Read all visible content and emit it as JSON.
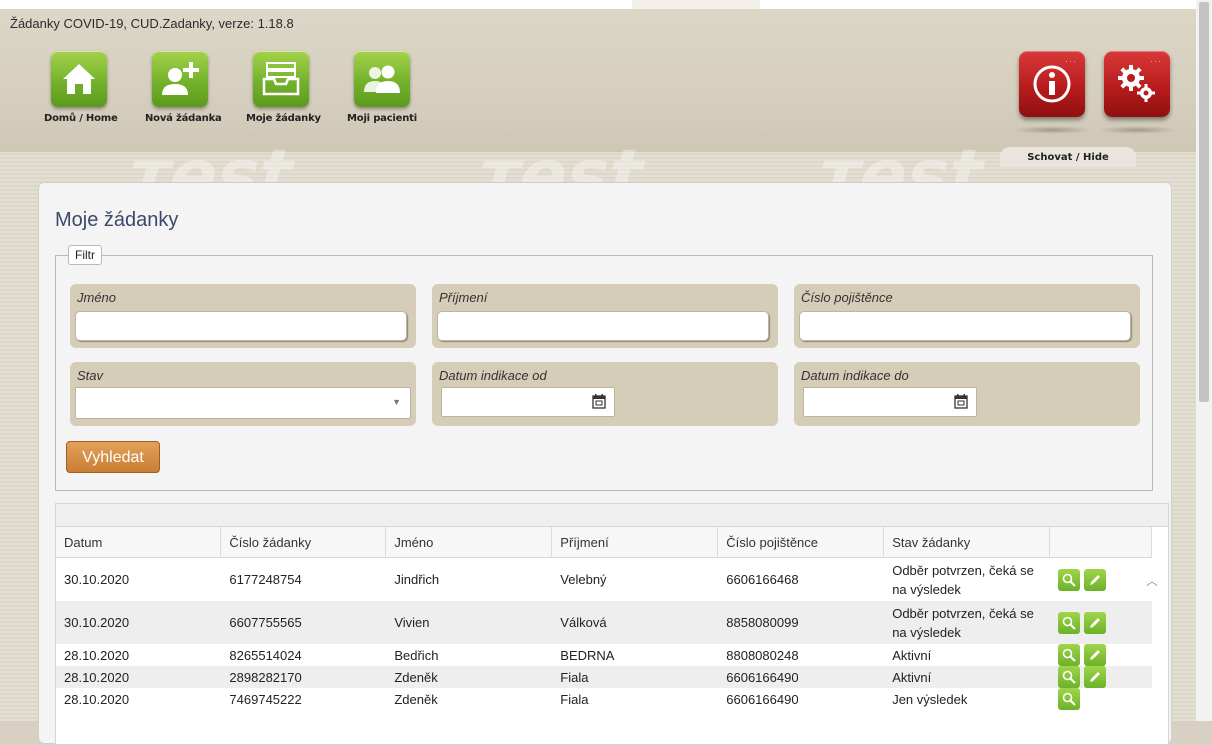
{
  "app_title": "Žádanky COVID-19, CUD.Zadanky, verze: 1.18.8",
  "nav": {
    "home": "Domů / Home",
    "new_request": "Nová žádanka",
    "my_requests": "Moje žádanky",
    "my_patients": "Moji pacienti"
  },
  "hide_label": "Schovat / Hide",
  "page_title": "Moje žádanky",
  "filter": {
    "legend": "Filtr",
    "first_name_label": "Jméno",
    "last_name_label": "Příjmení",
    "insurance_label": "Číslo pojištěnce",
    "status_label": "Stav",
    "date_from_label": "Datum indikace od",
    "date_to_label": "Datum indikace do",
    "search_button": "Vyhledat"
  },
  "table": {
    "columns": [
      "Datum",
      "Číslo žádanky",
      "Jméno",
      "Příjmení",
      "Číslo pojištěnce",
      "Stav žádanky"
    ],
    "rows": [
      {
        "date": "30.10.2020",
        "number": "6177248754",
        "first": "Jindřich",
        "last": "Velebný",
        "insurance": "6606166468",
        "status": "Odběr potvrzen, čeká se na výsledek",
        "edit": true
      },
      {
        "date": "30.10.2020",
        "number": "6607755565",
        "first": "Vivien",
        "last": "Válková",
        "insurance": "8858080099",
        "status": "Odběr potvrzen, čeká se na výsledek",
        "edit": true
      },
      {
        "date": "28.10.2020",
        "number": "8265514024",
        "first": "Bedřich",
        "last": "BEDRNA",
        "insurance": "8808080248",
        "status": "Aktivní",
        "edit": true
      },
      {
        "date": "28.10.2020",
        "number": "2898282170",
        "first": "Zdeněk",
        "last": "Fiala",
        "insurance": "6606166490",
        "status": "Aktivní",
        "edit": true
      },
      {
        "date": "28.10.2020",
        "number": "7469745222",
        "first": "Zdeněk",
        "last": "Fiala",
        "insurance": "6606166490",
        "status": "Jen výsledek",
        "edit": false
      }
    ]
  }
}
